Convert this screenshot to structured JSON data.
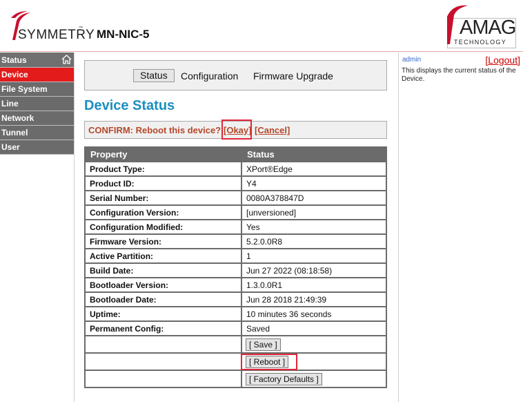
{
  "header": {
    "brand_left": "SYMMETRY",
    "brand_tm": "™",
    "device_name": "MN-NIC-5",
    "brand_right": "AMAG",
    "brand_right_sub": "TECHNOLOGY"
  },
  "sidebar": {
    "items": [
      {
        "label": "Status",
        "icon": "home-icon"
      },
      {
        "label": "Device"
      },
      {
        "label": "File System"
      },
      {
        "label": "Line"
      },
      {
        "label": "Network"
      },
      {
        "label": "Tunnel"
      },
      {
        "label": "User"
      }
    ],
    "active": "Device"
  },
  "tabs": [
    {
      "label": "Status",
      "selected": true
    },
    {
      "label": "Configuration",
      "selected": false
    },
    {
      "label": "Firmware Upgrade",
      "selected": false
    }
  ],
  "page_title": "Device Status",
  "confirm": {
    "text": "CONFIRM: Reboot this device?",
    "okay": "[Okay]",
    "cancel": "[Cancel]"
  },
  "table": {
    "headers": [
      "Property",
      "Status"
    ],
    "rows": [
      [
        "Product Type:",
        "XPort®Edge"
      ],
      [
        "Product ID:",
        "Y4"
      ],
      [
        "Serial Number:",
        "0080A378847D"
      ],
      [
        "Configuration Version:",
        "[unversioned]"
      ],
      [
        "Configuration Modified:",
        "Yes"
      ],
      [
        "Firmware Version:",
        "5.2.0.0R8"
      ],
      [
        "Active Partition:",
        "1"
      ],
      [
        "Build Date:",
        "Jun 27 2022 (08:18:58)"
      ],
      [
        "Bootloader Version:",
        "1.3.0.0R1"
      ],
      [
        "Bootloader Date:",
        "Jun 28 2018 21:49:39"
      ],
      [
        "Uptime:",
        "10 minutes 36 seconds"
      ],
      [
        "Permanent Config:",
        "Saved"
      ]
    ],
    "buttons": {
      "save": "[ Save ]",
      "reboot": "[ Reboot ]",
      "factory": "[ Factory Defaults ]"
    }
  },
  "right_panel": {
    "user": "admin",
    "logout_open": "[",
    "logout": "Logout",
    "logout_close": "]",
    "help": "This displays the current status of the Device."
  },
  "colors": {
    "nav_bg": "#6b6b6b",
    "nav_active": "#e31b1b",
    "title": "#1b8ec0",
    "confirm_text": "#b5482a",
    "highlight": "#e0253a"
  }
}
